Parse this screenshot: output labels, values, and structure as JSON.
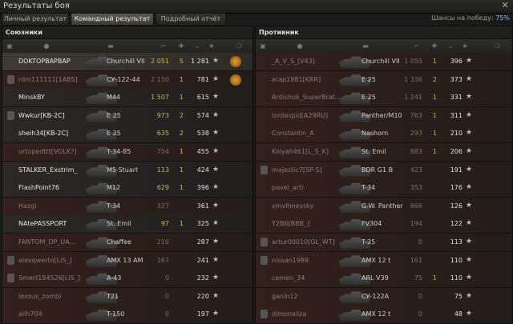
{
  "window": {
    "title": "Результаты боя",
    "close_icon": "close-icon"
  },
  "tabs": [
    {
      "label": "Личный результат",
      "active": false
    },
    {
      "label": "Командный результат",
      "active": true
    },
    {
      "label": "Подробный отчёт",
      "active": false
    }
  ],
  "chances": {
    "label": "Шансы на победу:",
    "value": "75%"
  },
  "allies": {
    "title": "Союзники",
    "rows": [
      {
        "name": "DOKTOPBAPBAP",
        "vehicle": "Churchill VII",
        "damage": "2 051",
        "kills": "5",
        "xp": "1 281",
        "alive": true,
        "self": true,
        "medal": true,
        "clan_tag": false
      },
      {
        "name": "rdm111111[1ABS]",
        "vehicle": "СУ-122-44",
        "damage": "2 150",
        "kills": "1",
        "xp": "781",
        "alive": false,
        "medal": true,
        "clan_tag": true
      },
      {
        "name": "MinskBY",
        "vehicle": "M44",
        "damage": "1 507",
        "kills": "1",
        "xp": "615",
        "alive": true,
        "clan_tag": false
      },
      {
        "name": "Wwkur[KB-2C]",
        "vehicle": "E 25",
        "damage": "973",
        "kills": "2",
        "xp": "574",
        "alive": true,
        "clan_tag": true
      },
      {
        "name": "sheih34[KB-2C]",
        "vehicle": "E 25",
        "damage": "635",
        "kills": "2",
        "xp": "538",
        "alive": true,
        "clan_tag": false
      },
      {
        "name": "ortopedttt[VOLK?]",
        "vehicle": "T-34-85",
        "damage": "754",
        "kills": "1",
        "xp": "455",
        "alive": false,
        "clan_tag": false
      },
      {
        "name": "STALKER_Exstrim_",
        "vehicle": "M5 Stuart",
        "damage": "113",
        "kills": "1",
        "xp": "424",
        "alive": true,
        "clan_tag": false
      },
      {
        "name": "FlashPoint76",
        "vehicle": "M12",
        "damage": "629",
        "kills": "1",
        "xp": "396",
        "alive": true,
        "clan_tag": false
      },
      {
        "name": "Hazgi",
        "vehicle": "T-34",
        "damage": "327",
        "kills": "",
        "xp": "361",
        "alive": false,
        "clan_tag": false
      },
      {
        "name": "NAtePASSPORT",
        "vehicle": "St. Emil",
        "damage": "97",
        "kills": "1",
        "xp": "325",
        "alive": true,
        "clan_tag": false
      },
      {
        "name": "FANTOM_DP_UA...",
        "vehicle": "Chaffee",
        "damage": "219",
        "kills": "",
        "xp": "287",
        "alive": false,
        "clan_tag": false
      },
      {
        "name": "alexqwerto[LIS_]",
        "vehicle": "AMX 13 AM",
        "damage": "167",
        "kills": "",
        "xp": "241",
        "alive": false,
        "clan_tag": true
      },
      {
        "name": "Smert194526[LIS_]",
        "vehicle": "A-43",
        "damage": "0",
        "kills": "",
        "xp": "232",
        "alive": false,
        "clan_tag": true
      },
      {
        "name": "lexsus_zombi",
        "vehicle": "T21",
        "damage": "0",
        "kills": "",
        "xp": "220",
        "alive": false,
        "clan_tag": false
      },
      {
        "name": "alih704",
        "vehicle": "T-150",
        "damage": "0",
        "kills": "",
        "xp": "197",
        "alive": false,
        "clan_tag": false
      }
    ]
  },
  "enemies": {
    "title": "Противник",
    "rows": [
      {
        "name": "_A_V_S_[V43]",
        "vehicle": "Churchill VII",
        "damage": "1 055",
        "kills": "1",
        "xp": "396",
        "alive": false,
        "clan_tag": false
      },
      {
        "name": "arap1981[KRR]",
        "vehicle": "E 25",
        "damage": "1 336",
        "kills": "2",
        "xp": "373",
        "alive": false,
        "clan_tag": false
      },
      {
        "name": "Antishok_SuperBrat...",
        "vehicle": "E 25",
        "damage": "1 241",
        "kills": "1",
        "xp": "331",
        "alive": false,
        "clan_tag": false
      },
      {
        "name": "lordaspid[A29RU]",
        "vehicle": "Panther/M10",
        "damage": "763",
        "kills": "1",
        "xp": "311",
        "alive": false,
        "clan_tag": false
      },
      {
        "name": "Constantin_A",
        "vehicle": "Nashorn",
        "damage": "293",
        "kills": "1",
        "xp": "210",
        "alive": false,
        "clan_tag": false
      },
      {
        "name": "Kolyah461[L_S_K]",
        "vehicle": "St. Emil",
        "damage": "883",
        "kills": "1",
        "xp": "206",
        "alive": false,
        "clan_tag": false
      },
      {
        "name": "majestic7[SP-S]",
        "vehicle": "BDR G1 B",
        "damage": "423",
        "kills": "",
        "xp": "191",
        "alive": false,
        "clan_tag": true
      },
      {
        "name": "pavel_arti",
        "vehicle": "T-34",
        "damage": "353",
        "kills": "",
        "xp": "176",
        "alive": false,
        "clan_tag": false
      },
      {
        "name": "vmvlhnevsky",
        "vehicle": "G.W. Panther",
        "damage": "666",
        "kills": "",
        "xp": "126",
        "alive": false,
        "clan_tag": false
      },
      {
        "name": "Y2B6[BBB_]",
        "vehicle": "FV304",
        "damage": "194",
        "kills": "",
        "xp": "122",
        "alive": false,
        "clan_tag": false
      },
      {
        "name": "artur00010[GL_WT]",
        "vehicle": "T-25",
        "damage": "0",
        "kills": "",
        "xp": "113",
        "alive": false,
        "clan_tag": true
      },
      {
        "name": "nissan1989",
        "vehicle": "AMX 12 t",
        "damage": "161",
        "kills": "",
        "xp": "110",
        "alive": false,
        "clan_tag": true
      },
      {
        "name": "cemen_34",
        "vehicle": "ARL V39",
        "damage": "75",
        "kills": "1",
        "xp": "110",
        "alive": false,
        "clan_tag": false
      },
      {
        "name": "ganin12",
        "vehicle": "СУ-122А",
        "damage": "0",
        "kills": "",
        "xp": "75",
        "alive": false,
        "clan_tag": false
      },
      {
        "name": "dimonaliza",
        "vehicle": "AMX 12 t",
        "damage": "0",
        "kills": "",
        "xp": "48",
        "alive": false,
        "clan_tag": true
      }
    ]
  },
  "column_icons": [
    "platoon-icon",
    "player-icon",
    "vehicle-icon",
    "damage-icon",
    "kills-icon",
    "xp-icon",
    "star-icon",
    "medal-icon"
  ]
}
